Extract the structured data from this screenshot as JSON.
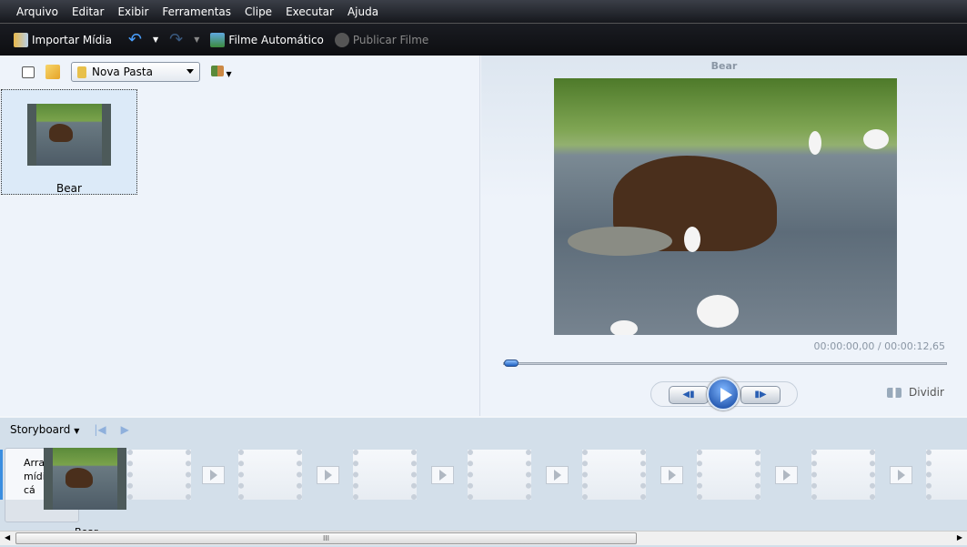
{
  "menu": [
    "Arquivo",
    "Editar",
    "Exibir",
    "Ferramentas",
    "Clipe",
    "Executar",
    "Ajuda"
  ],
  "toolbar": {
    "import": "Importar Mídia",
    "auto_movie": "Filme Automático",
    "publish": "Publicar Filme"
  },
  "library": {
    "folder": "Nova Pasta",
    "clips": [
      {
        "name": "Bear"
      }
    ]
  },
  "preview": {
    "title": "Bear",
    "time": "00:00:00,00 / 00:00:12,65",
    "progress": 0,
    "split": "Dividir"
  },
  "storyboard": {
    "view": "Storyboard",
    "placeholder": "Arraste a mídia para cá",
    "drag_label": "Bear",
    "scroll_grip": "III"
  }
}
